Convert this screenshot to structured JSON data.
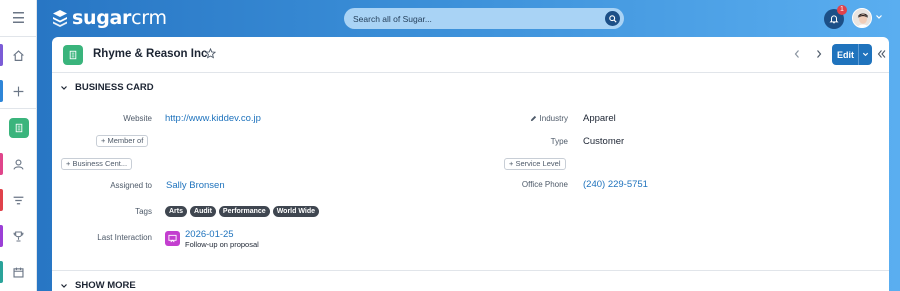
{
  "app": {
    "brand_light": "sugar",
    "brand_bold": "crm"
  },
  "search": {
    "placeholder": "Search all of Sugar..."
  },
  "notifications": {
    "count": "1"
  },
  "nav": {
    "items": [
      {
        "name": "home",
        "icon": "home-icon",
        "color": "#7b5cd6"
      },
      {
        "name": "quick-create",
        "icon": "plus-icon",
        "color": "#2f86d8"
      },
      {
        "name": "accounts",
        "icon": "accounts-icon",
        "color": "#3ab47c"
      },
      {
        "name": "contacts",
        "icon": "person-icon",
        "color": "#e0458b"
      },
      {
        "name": "leads",
        "icon": "filter-icon",
        "color": "#e0424b"
      },
      {
        "name": "opportunities",
        "icon": "trophy-icon",
        "color": "#9b3fd6"
      },
      {
        "name": "calendar",
        "icon": "calendar-icon",
        "color": "#2aa39a"
      }
    ]
  },
  "record": {
    "title": "Rhyme & Reason Inc",
    "edit_label": "Edit"
  },
  "sections": {
    "business_card": "BUSINESS CARD",
    "show_more": "SHOW MORE"
  },
  "fields": {
    "website_label": "Website",
    "website": "http://www.kiddev.co.jp",
    "member_of": "Member of",
    "business_center": "Business Cent...",
    "assigned_label": "Assigned to",
    "assigned": "Sally Bronsen",
    "tags_label": "Tags",
    "tags": [
      "Arts",
      "Audit",
      "Performance",
      "World Wide"
    ],
    "last_interaction_label": "Last Interaction",
    "last_interaction_date": "2026-01-25",
    "last_interaction_desc": "Follow-up on proposal",
    "industry_label": "Industry",
    "industry": "Apparel",
    "type_label": "Type",
    "type": "Customer",
    "service_level": "Service Level",
    "office_phone_label": "Office Phone",
    "office_phone": "(240) 229-5751"
  }
}
